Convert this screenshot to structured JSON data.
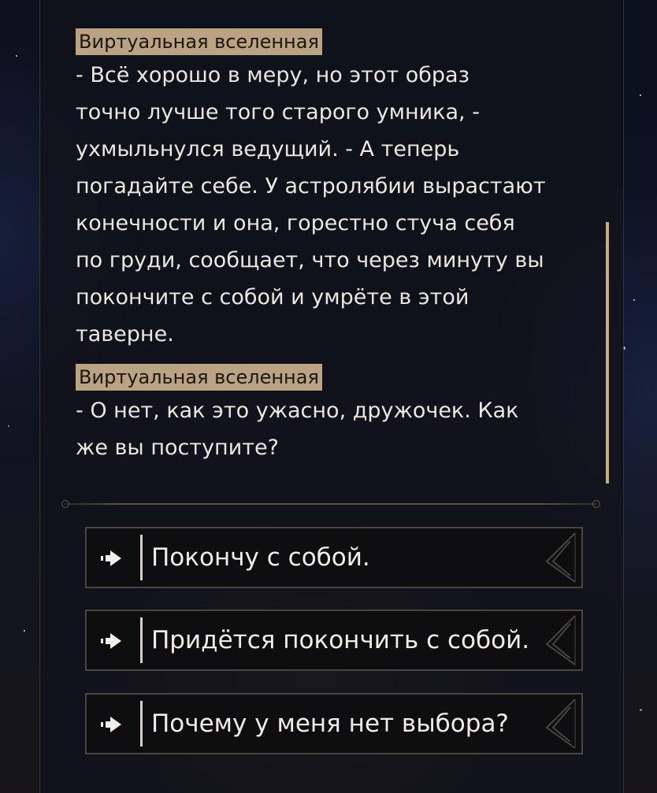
{
  "story": {
    "blocks": [
      {
        "speaker": "Виртуальная вселенная",
        "lines": [
          "- Всё хорошо в меру, но этот образ",
          "точно лучше того старого умника, -",
          "ухмыльнулся ведущий. - А теперь",
          "погадайте себе. У астролябии вырастают",
          "конечности и она, горестно стуча себя",
          "по груди, сообщает, что через минуту вы",
          "покончите с собой и умрёте в этой",
          "таверне."
        ]
      },
      {
        "speaker": "Виртуальная вселенная",
        "lines": [
          "- О нет, как это ужасно, дружочек. Как",
          "же вы поступите?"
        ]
      }
    ]
  },
  "choices": [
    {
      "label": "Покончу с собой.",
      "icon": "arrow-right-icon"
    },
    {
      "label": "Придётся покончить с собой.",
      "icon": "arrow-right-icon"
    },
    {
      "label": "Почему у меня нет выбора?",
      "icon": "arrow-right-icon"
    }
  ],
  "colors": {
    "speaker_tag_bg": "#b9a382",
    "text": "#ece7de",
    "scrollbar": "#c8ad7e",
    "choice_bg": "#0e0e10"
  }
}
